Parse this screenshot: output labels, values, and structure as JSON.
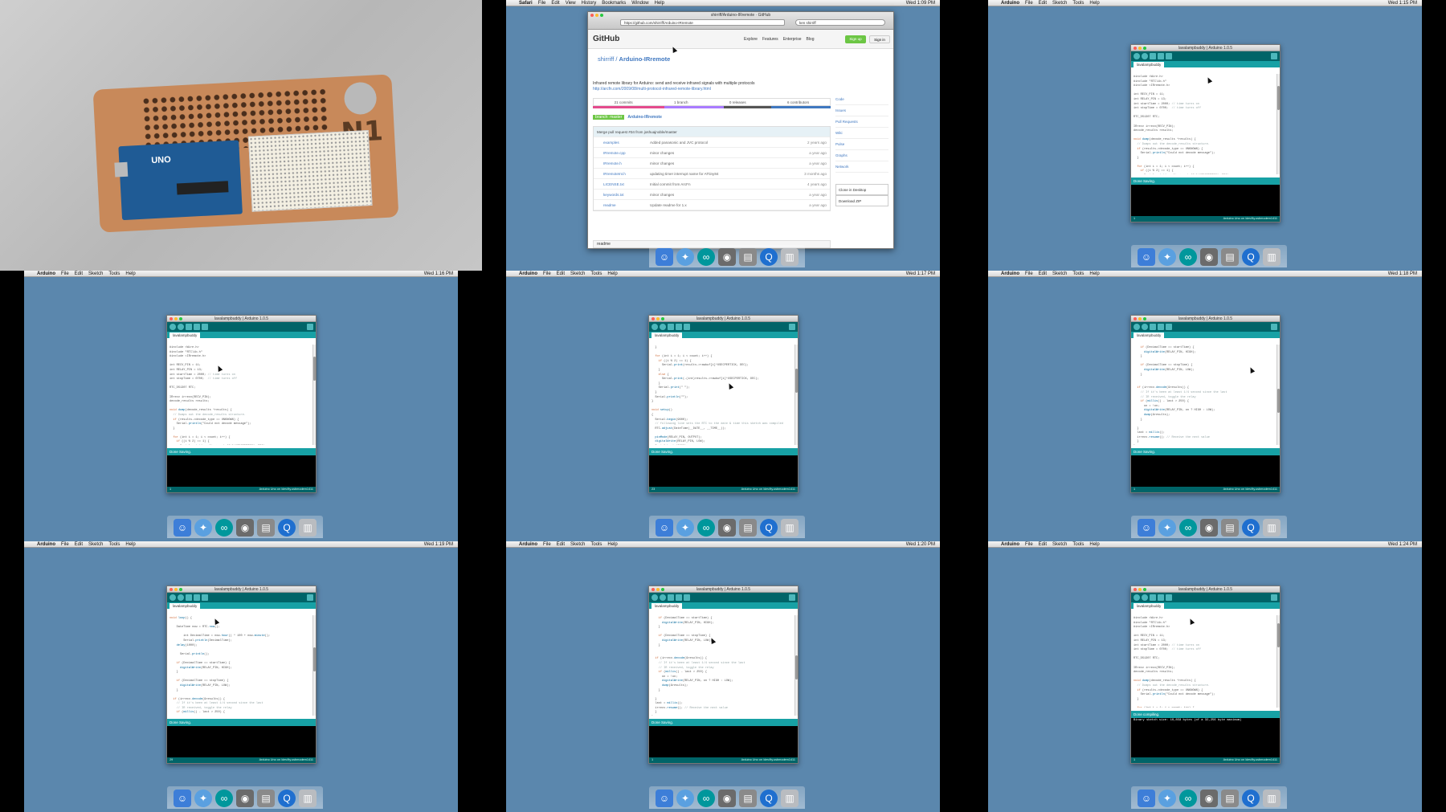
{
  "menubar_common": {
    "apple": "",
    "app": "Arduino",
    "items": [
      "File",
      "Edit",
      "Sketch",
      "Tools",
      "Help"
    ],
    "status": "Wed"
  },
  "safari_menubar": {
    "app": "Safari",
    "items": [
      "File",
      "Edit",
      "View",
      "History",
      "Bookmarks",
      "Window",
      "Help"
    ],
    "time": "Wed 1:09 PM"
  },
  "times": [
    "Wed 1:15 PM",
    "Wed 1:16 PM",
    "Wed 1:17 PM",
    "Wed 1:18 PM",
    "Wed 1:19 PM",
    "Wed 1:20 PM",
    "Wed 1:24 PM"
  ],
  "photo": {
    "label": "N1",
    "board": "UNO"
  },
  "github": {
    "window_title": "shirriff/Arduino-IRremote · GitHub",
    "url": "https://github.com/shirriff/Arduino-IRremote",
    "search": "ken shirriff",
    "logo": "GitHub",
    "nav": [
      "Explore",
      "Features",
      "Enterprise",
      "Blog"
    ],
    "signup": "Sign up",
    "signin": "Sign in",
    "owner": "shirriff",
    "repo": "Arduino-IRremote",
    "description": "Infrared remote library for Arduino: send and receive infrared signals with multiple protocols",
    "link": "http://arcfn.com/2009/08/multi-protocol-infrared-remote-library.html",
    "stats": [
      "21 commits",
      "1 branch",
      "0 releases",
      "6 contributors"
    ],
    "branch_label": "branch: master",
    "path": "Arduino-IRremote",
    "commit_msg": "Merge pull request #34 from joshuajnoble/master",
    "files": [
      {
        "name": "examples",
        "msg": "Added panasonic and JVC protocol",
        "age": "2 years ago"
      },
      {
        "name": "IRremote.cpp",
        "msg": "minor changes",
        "age": "a year ago"
      },
      {
        "name": "IRremote.h",
        "msg": "minor changes",
        "age": "a year ago"
      },
      {
        "name": "IRremoteInt.h",
        "msg": "updating timer interrupt name for ATtiny84",
        "age": "3 months ago"
      },
      {
        "name": "LICENSE.txt",
        "msg": "Initial commit from ArcFn",
        "age": "4 years ago"
      },
      {
        "name": "keywords.txt",
        "msg": "minor changes",
        "age": "a year ago"
      },
      {
        "name": "readme",
        "msg": "Update readme for 1.x",
        "age": "a year ago"
      }
    ],
    "side": [
      "Code",
      "Issues",
      "Pull Requests",
      "Wiki",
      "Pulse",
      "Graphs",
      "Network"
    ],
    "clone": "Clone in Desktop",
    "download": "Download ZIP",
    "readme_label": "readme"
  },
  "arduino": {
    "window_title": "lavalampbuddy | Arduino 1.0.5",
    "tab": "lavalampbuddy",
    "status_done_saving": "Done Saving.",
    "status_done_compiling": "Done compiling.",
    "compile_output": "Binary sketch size: 10,858 bytes (of a 32,256 byte maximum)",
    "footer_board": "Arduino Uno on /dev/tty.usbmodem1411",
    "line_numbers": [
      "1",
      "1",
      "23",
      "1",
      "29",
      "1",
      "54 - 68",
      "1"
    ]
  },
  "dock_icons": [
    "finder-icon",
    "safari-icon",
    "arduino-icon",
    "photos-icon",
    "preview-icon",
    "quicktime-icon",
    "trash-icon"
  ]
}
